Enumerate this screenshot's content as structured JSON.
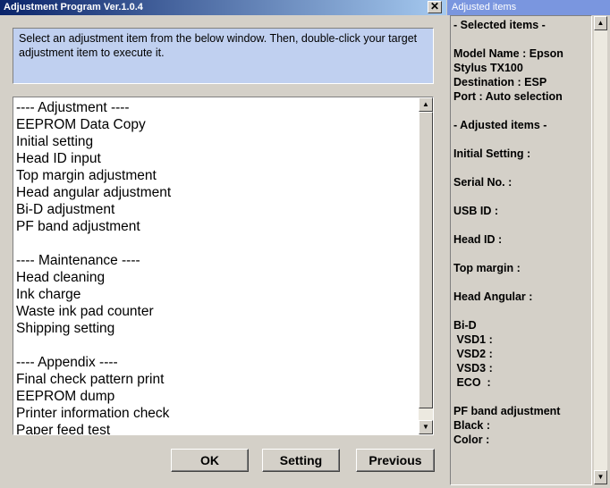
{
  "main_window": {
    "title": "Adjustment Program Ver.1.0.4",
    "close_glyph": "✕",
    "instruction": "Select an adjustment item from the below window. Then, double-click your target adjustment item to execute it.",
    "list_items": [
      "---- Adjustment ----",
      "EEPROM Data Copy",
      "Initial setting",
      "Head ID input",
      "Top margin adjustment",
      "Head angular adjustment",
      "Bi-D adjustment",
      "PF band adjustment",
      "",
      "---- Maintenance ----",
      "Head cleaning",
      "Ink charge",
      "Waste ink pad counter",
      "Shipping setting",
      "",
      "---- Appendix ----",
      "Final check pattern print",
      "EEPROM dump",
      "Printer information check",
      "Paper feed test"
    ],
    "buttons": {
      "ok": "OK",
      "setting": "Setting",
      "previous": "Previous"
    },
    "scroll_up": "▲",
    "scroll_down": "▼"
  },
  "side_window": {
    "title": "Adjusted items",
    "lines": [
      "- Selected items -",
      "",
      "Model Name : Epson",
      "Stylus TX100",
      "Destination : ESP",
      "Port : Auto selection",
      "",
      "- Adjusted items -",
      "",
      "Initial Setting :",
      "",
      "Serial No. :",
      "",
      "USB ID :",
      "",
      "Head ID :",
      "",
      "Top margin :",
      "",
      "Head Angular :",
      "",
      "Bi-D",
      " VSD1 :",
      " VSD2 :",
      " VSD3 :",
      " ECO  :",
      "",
      "PF band adjustment",
      "Black :",
      "Color :"
    ],
    "scroll_up": "▲",
    "scroll_down": "▼"
  },
  "colors": {
    "titlebar_active": "#0a246a",
    "titlebar_inactive": "#7a96df",
    "instruction_bg": "#c0d0f0",
    "face": "#d4d0c8"
  }
}
